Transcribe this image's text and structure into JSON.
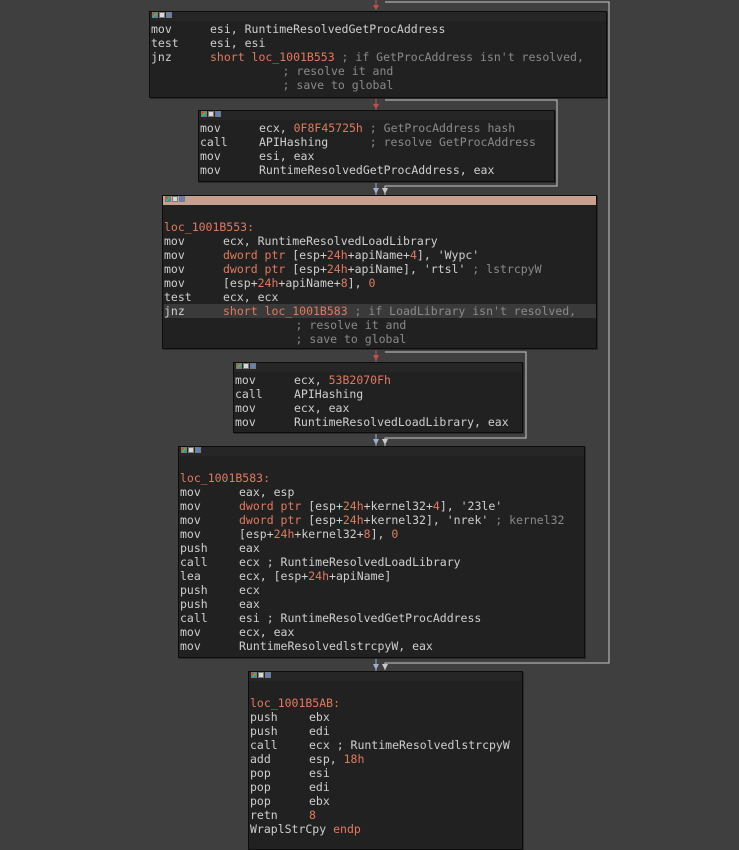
{
  "theme": {
    "background": "#3f3f3f",
    "node_bg": "#212121",
    "label_color": "#e07a5f",
    "comment_color": "#8a8a8a",
    "edge_true": "#5ba05b",
    "edge_false": "#c05050",
    "edge_default": "#9ab0cc",
    "selected_titlebar": "#c7a090"
  },
  "nodes": [
    {
      "id": "block-1",
      "lines": [
        {
          "mn": "mov",
          "ops": [
            {
              "t": "esi, RuntimeResolvedGetProcAddress",
              "c": "op"
            }
          ]
        },
        {
          "mn": "test",
          "ops": [
            {
              "t": "esi, esi",
              "c": "op"
            }
          ]
        },
        {
          "mn": "jnz",
          "ops": [
            {
              "t": "short loc_1001B553",
              "c": "lbl"
            },
            {
              "t": " ; if GetProcAddress isn't resolved,",
              "c": "cmt"
            }
          ]
        },
        {
          "mn": "",
          "ops": [
            {
              "t": "                   ; resolve it and",
              "c": "cmt"
            }
          ]
        },
        {
          "mn": "",
          "ops": [
            {
              "t": "                   ; save to global",
              "c": "cmt"
            }
          ]
        }
      ]
    },
    {
      "id": "block-2",
      "lines": [
        {
          "mn": "mov",
          "ops": [
            {
              "t": "ecx, ",
              "c": "op"
            },
            {
              "t": "0F8F45725h",
              "c": "num"
            },
            {
              "t": " ; GetProcAddress hash",
              "c": "cmt"
            }
          ]
        },
        {
          "mn": "call",
          "ops": [
            {
              "t": "APIHashing      ",
              "c": "op"
            },
            {
              "t": "; resolve GetProcAddress",
              "c": "cmt"
            }
          ]
        },
        {
          "mn": "mov",
          "ops": [
            {
              "t": "esi, eax",
              "c": "op"
            }
          ]
        },
        {
          "mn": "mov",
          "ops": [
            {
              "t": "RuntimeResolvedGetProcAddress, eax",
              "c": "op"
            }
          ]
        }
      ]
    },
    {
      "id": "block-3",
      "lines": [
        {
          "mn": "",
          "ops": []
        },
        {
          "mn": "",
          "ops": [
            {
              "t": "loc_1001B553:",
              "c": "lbl"
            }
          ]
        },
        {
          "mn": "mov",
          "ops": [
            {
              "t": "ecx, RuntimeResolvedLoadLibrary",
              "c": "op"
            }
          ]
        },
        {
          "mn": "mov",
          "ops": [
            {
              "t": "dword ptr ",
              "c": "lbl"
            },
            {
              "t": "[esp+",
              "c": "op"
            },
            {
              "t": "24h",
              "c": "num"
            },
            {
              "t": "+apiName+",
              "c": "op"
            },
            {
              "t": "4",
              "c": "num"
            },
            {
              "t": "], ",
              "c": "op"
            },
            {
              "t": "'Wypc'",
              "c": "str"
            }
          ]
        },
        {
          "mn": "mov",
          "ops": [
            {
              "t": "dword ptr ",
              "c": "lbl"
            },
            {
              "t": "[esp+",
              "c": "op"
            },
            {
              "t": "24h",
              "c": "num"
            },
            {
              "t": "+apiName], ",
              "c": "op"
            },
            {
              "t": "'rtsl'",
              "c": "str"
            },
            {
              "t": " ; lstrcpyW",
              "c": "cmt"
            }
          ]
        },
        {
          "mn": "mov",
          "ops": [
            {
              "t": "[esp+",
              "c": "op"
            },
            {
              "t": "24h",
              "c": "num"
            },
            {
              "t": "+apiName+",
              "c": "op"
            },
            {
              "t": "8",
              "c": "num"
            },
            {
              "t": "], ",
              "c": "op"
            },
            {
              "t": "0",
              "c": "num"
            }
          ]
        },
        {
          "mn": "test",
          "ops": [
            {
              "t": "ecx, ecx",
              "c": "op"
            }
          ]
        },
        {
          "mn": "jnz",
          "cur": true,
          "ops": [
            {
              "t": "short loc_1001B583",
              "c": "lbl"
            },
            {
              "t": " ; if LoadLibrary isn't resolved,",
              "c": "cmt"
            }
          ]
        },
        {
          "mn": "",
          "ops": [
            {
              "t": "                   ; resolve it and",
              "c": "cmt"
            }
          ]
        },
        {
          "mn": "",
          "ops": [
            {
              "t": "                   ; save to global",
              "c": "cmt"
            }
          ]
        }
      ]
    },
    {
      "id": "block-4",
      "lines": [
        {
          "mn": "mov",
          "ops": [
            {
              "t": "ecx, ",
              "c": "op"
            },
            {
              "t": "53B2070Fh",
              "c": "num"
            }
          ]
        },
        {
          "mn": "call",
          "ops": [
            {
              "t": "APIHashing",
              "c": "op"
            }
          ]
        },
        {
          "mn": "mov",
          "ops": [
            {
              "t": "ecx, eax",
              "c": "op"
            }
          ]
        },
        {
          "mn": "mov",
          "ops": [
            {
              "t": "RuntimeResolvedLoadLibrary, eax",
              "c": "op"
            }
          ]
        }
      ]
    },
    {
      "id": "block-5",
      "lines": [
        {
          "mn": "",
          "ops": []
        },
        {
          "mn": "",
          "ops": [
            {
              "t": "loc_1001B583:",
              "c": "lbl"
            }
          ]
        },
        {
          "mn": "mov",
          "ops": [
            {
              "t": "eax, esp",
              "c": "op"
            }
          ]
        },
        {
          "mn": "mov",
          "ops": [
            {
              "t": "dword ptr ",
              "c": "lbl"
            },
            {
              "t": "[esp+",
              "c": "op"
            },
            {
              "t": "24h",
              "c": "num"
            },
            {
              "t": "+kernel32+",
              "c": "op"
            },
            {
              "t": "4",
              "c": "num"
            },
            {
              "t": "], ",
              "c": "op"
            },
            {
              "t": "'23le'",
              "c": "str"
            }
          ]
        },
        {
          "mn": "mov",
          "ops": [
            {
              "t": "dword ptr ",
              "c": "lbl"
            },
            {
              "t": "[esp+",
              "c": "op"
            },
            {
              "t": "24h",
              "c": "num"
            },
            {
              "t": "+kernel32], ",
              "c": "op"
            },
            {
              "t": "'nrek'",
              "c": "str"
            },
            {
              "t": " ; kernel32",
              "c": "cmt"
            }
          ]
        },
        {
          "mn": "mov",
          "ops": [
            {
              "t": "[esp+",
              "c": "op"
            },
            {
              "t": "24h",
              "c": "num"
            },
            {
              "t": "+kernel32+",
              "c": "op"
            },
            {
              "t": "8",
              "c": "num"
            },
            {
              "t": "], ",
              "c": "op"
            },
            {
              "t": "0",
              "c": "num"
            }
          ]
        },
        {
          "mn": "push",
          "ops": [
            {
              "t": "eax",
              "c": "op"
            }
          ]
        },
        {
          "mn": "call",
          "ops": [
            {
              "t": "ecx ; RuntimeResolvedLoadLibrary",
              "c": "op"
            }
          ]
        },
        {
          "mn": "lea",
          "ops": [
            {
              "t": "ecx, [esp+",
              "c": "op"
            },
            {
              "t": "24h",
              "c": "num"
            },
            {
              "t": "+apiName]",
              "c": "op"
            }
          ]
        },
        {
          "mn": "push",
          "ops": [
            {
              "t": "ecx",
              "c": "op"
            }
          ]
        },
        {
          "mn": "push",
          "ops": [
            {
              "t": "eax",
              "c": "op"
            }
          ]
        },
        {
          "mn": "call",
          "ops": [
            {
              "t": "esi ; RuntimeResolvedGetProcAddress",
              "c": "op"
            }
          ]
        },
        {
          "mn": "mov",
          "ops": [
            {
              "t": "ecx, eax",
              "c": "op"
            }
          ]
        },
        {
          "mn": "mov",
          "ops": [
            {
              "t": "RuntimeResolvedlstrcpyW, eax",
              "c": "op"
            }
          ]
        }
      ]
    },
    {
      "id": "block-6",
      "lines": [
        {
          "mn": "",
          "ops": []
        },
        {
          "mn": "",
          "ops": [
            {
              "t": "loc_1001B5AB:",
              "c": "lbl"
            }
          ]
        },
        {
          "mn": "push",
          "ops": [
            {
              "t": "ebx",
              "c": "op"
            }
          ]
        },
        {
          "mn": "push",
          "ops": [
            {
              "t": "edi",
              "c": "op"
            }
          ]
        },
        {
          "mn": "call",
          "ops": [
            {
              "t": "ecx ; RuntimeResolvedlstrcpyW",
              "c": "op"
            }
          ]
        },
        {
          "mn": "add",
          "ops": [
            {
              "t": "esp, ",
              "c": "op"
            },
            {
              "t": "18h",
              "c": "num"
            }
          ]
        },
        {
          "mn": "pop",
          "ops": [
            {
              "t": "esi",
              "c": "op"
            }
          ]
        },
        {
          "mn": "pop",
          "ops": [
            {
              "t": "edi",
              "c": "op"
            }
          ]
        },
        {
          "mn": "pop",
          "ops": [
            {
              "t": "ebx",
              "c": "op"
            }
          ]
        },
        {
          "mn": "retn",
          "ops": [
            {
              "t": "8",
              "c": "num"
            }
          ]
        },
        {
          "mn": "",
          "ops": [
            {
              "t": "WraplStrCpy ",
              "c": "op"
            },
            {
              "t": "endp",
              "c": "lbl"
            }
          ]
        }
      ]
    }
  ]
}
